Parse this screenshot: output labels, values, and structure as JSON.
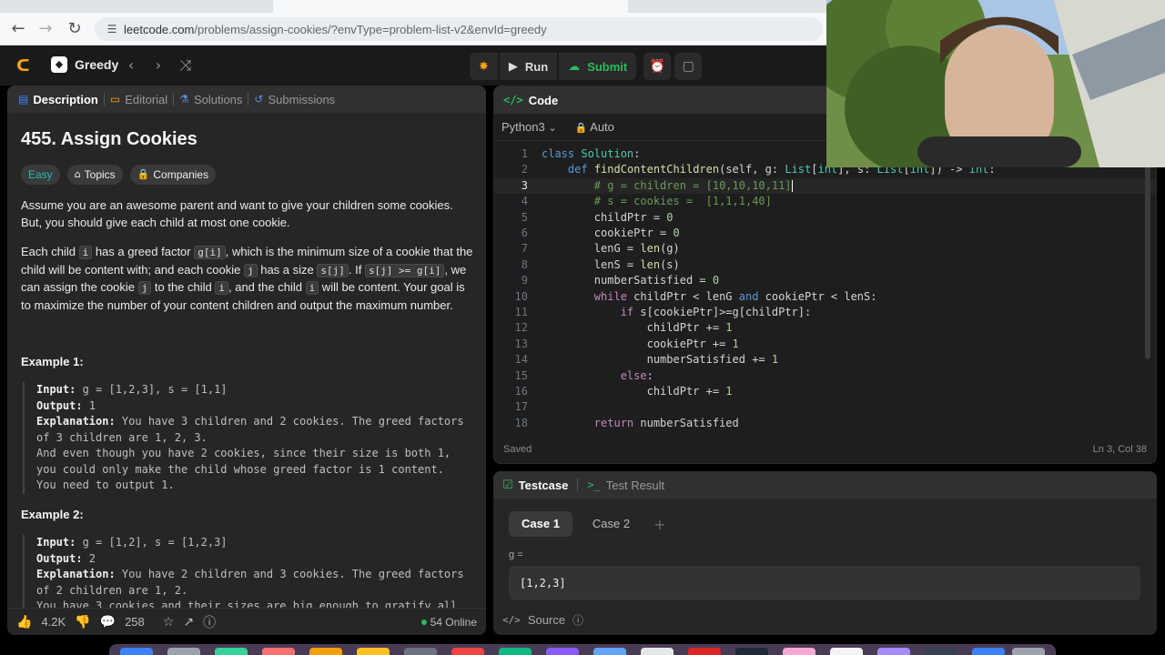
{
  "browser": {
    "url_main": "leetcode.com",
    "url_rest": "/problems/assign-cookies/?envType=problem-list-v2&envId=greedy"
  },
  "header": {
    "list_name": "Greedy",
    "run_label": "Run",
    "submit_label": "Submit"
  },
  "left_tabs": [
    {
      "label": "Description"
    },
    {
      "label": "Editorial"
    },
    {
      "label": "Solutions"
    },
    {
      "label": "Submissions"
    }
  ],
  "problem": {
    "title": "455. Assign Cookies",
    "difficulty": "Easy",
    "topics_label": "Topics",
    "companies_label": "Companies",
    "p1": "Assume you are an awesome parent and want to give your children some cookies. But, you should give each child at most one cookie.",
    "p2": {
      "a": "Each child ",
      "c1": "i",
      "b": " has a greed factor ",
      "c2": "g[i]",
      "c": ", which is the minimum size of a cookie that the child will be content with; and each cookie ",
      "c3": "j",
      "d": " has a size ",
      "c4": "s[j]",
      "e": ". If ",
      "c5": "s[j] >= g[i]",
      "f": ", we can assign the cookie ",
      "c6": "j",
      "g": " to the child ",
      "c7": "i",
      "h": ", and the child ",
      "c8": "i",
      "i": " will be content. Your goal is to maximize the number of your content children and output the maximum number."
    },
    "ex1_title": "Example 1:",
    "ex1": {
      "input_label": "Input:",
      "input": " g = [1,2,3], s = [1,1]",
      "output_label": "Output:",
      "output": " 1",
      "expl_label": "Explanation:",
      "expl1": " You have 3 children and 2 cookies. The greed factors",
      "expl2": "of 3 children are 1, 2, 3.",
      "expl3": "And even though you have 2 cookies, since their size is both 1,",
      "expl4": "you could only make the child whose greed factor is 1 content.",
      "expl5": "You need to output 1."
    },
    "ex2_title": "Example 2:",
    "ex2": {
      "input_label": "Input:",
      "input": " g = [1,2], s = [1,2,3]",
      "output_label": "Output:",
      "output": " 2",
      "expl_label": "Explanation:",
      "expl1": " You have 2 children and 3 cookies. The greed factors",
      "expl2": "of 2 children are 1, 2.",
      "expl3": "You have 3 cookies and their sizes are big enough to gratify all"
    }
  },
  "left_footer": {
    "likes": "4.2K",
    "comments": "258",
    "online": "54 Online"
  },
  "code": {
    "title": "Code",
    "language": "Python3",
    "auto": "Auto",
    "saved": "Saved",
    "position": "Ln 3, Col 38",
    "current_line": 3
  },
  "testcase": {
    "tab": "Testcase",
    "result_tab": "Test Result",
    "cases": [
      "Case 1",
      "Case 2"
    ],
    "var_label": "g =",
    "var_value": "[1,2,3]",
    "source_label": "Source"
  }
}
